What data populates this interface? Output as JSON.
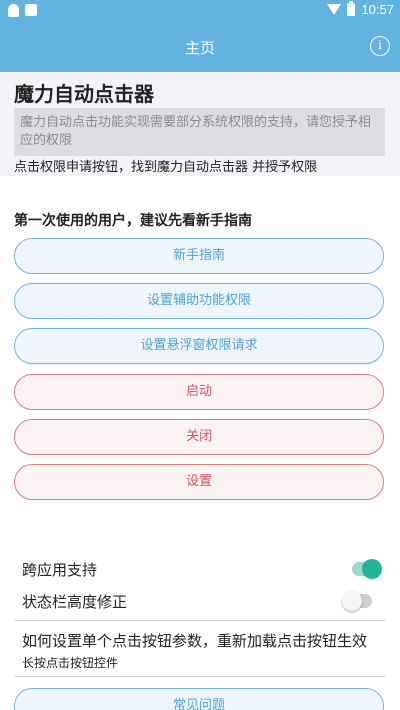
{
  "status_bar": {
    "time": "10:57",
    "left_icons": [
      "qq-icon",
      "notification-icon"
    ],
    "right_icons": [
      "wifi-icon",
      "battery-icon"
    ]
  },
  "app_bar": {
    "title": "主页",
    "info_icon": "info-icon",
    "info_glyph": "i"
  },
  "header": {
    "app_title": "魔力自动点击器",
    "description": "魔力自动点击功能实现需要部分系统权限的支持，请您授予相应的权限",
    "hint": "点击权限申请按钮，找到魔力自动点击器 并授予权限"
  },
  "guide_label": "第一次使用的用户，建议先看新手指南",
  "buttons": [
    {
      "label": "新手指南",
      "style": "blue"
    },
    {
      "label": "设置辅助功能权限",
      "style": "blue"
    },
    {
      "label": "设置悬浮窗权限请求",
      "style": "blue"
    },
    {
      "label": "启动",
      "style": "red"
    },
    {
      "label": "关闭",
      "style": "red"
    },
    {
      "label": "设置",
      "style": "red"
    }
  ],
  "settings": [
    {
      "label": "跨应用支持",
      "enabled": true
    },
    {
      "label": "状态栏高度修正",
      "enabled": false
    }
  ],
  "note": {
    "title": "如何设置单个点击按钮参数，重新加载点击按钮生效",
    "subtitle": "长按点击按钮控件"
  },
  "faq_button": {
    "label": "常见问题"
  },
  "colors": {
    "primary": "#62b3e0",
    "blue_button": "#4fa3d3",
    "red_button": "#d8515e",
    "switch_on": "#22b39b"
  }
}
